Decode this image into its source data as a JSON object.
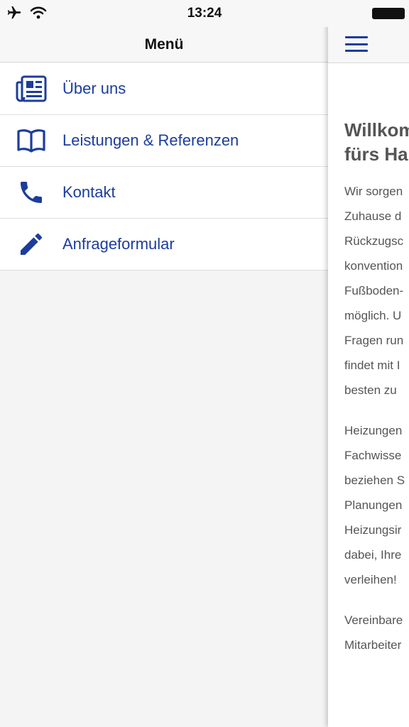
{
  "status_bar": {
    "time": "13:24",
    "icons": [
      "airplane-icon",
      "wifi-icon",
      "battery-icon"
    ]
  },
  "menu": {
    "title": "Menü",
    "items": [
      {
        "label": "Über uns",
        "icon": "newspaper-icon"
      },
      {
        "label": "Leistungen & Referenzen",
        "icon": "book-icon"
      },
      {
        "label": "Kontakt",
        "icon": "phone-icon"
      },
      {
        "label": "Anfrageformular",
        "icon": "pencil-icon"
      }
    ]
  },
  "content": {
    "heading_lines": [
      "Willkom",
      "fürs Ha"
    ],
    "paragraphs": [
      [
        "Wir sorgen",
        "Zuhause d",
        "Rückzugsc",
        "konvention",
        "Fußboden-",
        "möglich. U",
        "Fragen run",
        "findet mit I",
        "besten zu"
      ],
      [
        "Heizungen",
        "Fachwisse",
        "beziehen S",
        "Planungen",
        "Heizungsir",
        "dabei, Ihre",
        "verleihen!"
      ],
      [
        "Vereinbare",
        "Mitarbeiter"
      ]
    ]
  },
  "colors": {
    "accent": "#1c3d9b",
    "text": "#555555",
    "menu_background": "#f4f4f4"
  }
}
